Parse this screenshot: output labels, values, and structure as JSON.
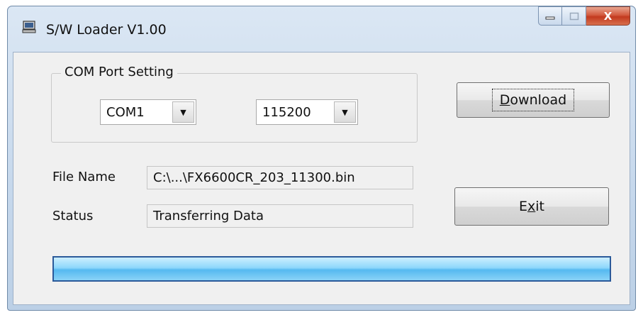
{
  "window": {
    "title": "S/W Loader V1.00"
  },
  "caption_buttons": {
    "close_glyph": "X"
  },
  "com_port": {
    "legend": "COM Port Setting",
    "port_value": "COM1",
    "baud_value": "115200"
  },
  "buttons": {
    "download_pre": "",
    "download_u": "D",
    "download_post": "ownload",
    "exit_pre": "E",
    "exit_u": "x",
    "exit_post": "it"
  },
  "file": {
    "label": "File Name",
    "value": "C:\\...\\FX6600CR_203_11300.bin"
  },
  "status": {
    "label": "Status",
    "value": "Transferring Data"
  },
  "progress": {
    "fraction": 1.0
  },
  "colors": {
    "progress_fill": "#55b9f0",
    "close_button": "#c23a1f"
  }
}
